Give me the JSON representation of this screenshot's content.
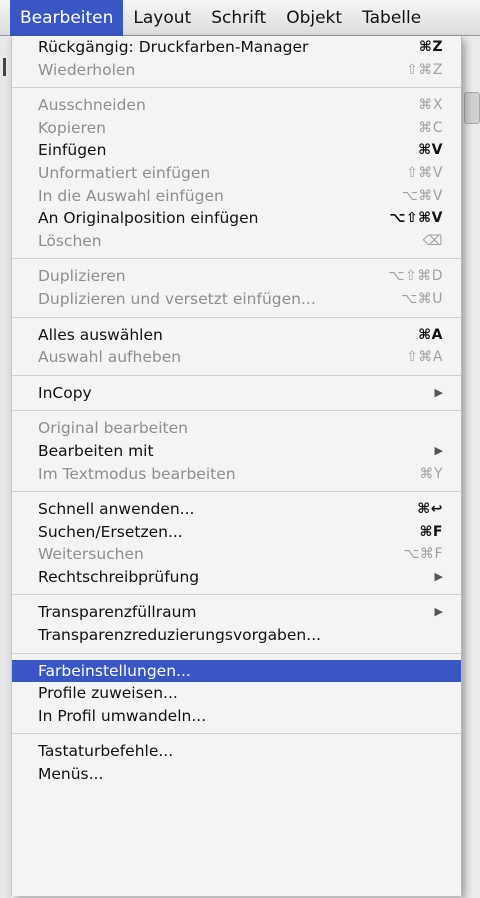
{
  "menubar": {
    "items": [
      "Bearbeiten",
      "Layout",
      "Schrift",
      "Objekt",
      "Tabelle"
    ]
  },
  "menu": {
    "groups": [
      [
        {
          "label": "Rückgängig: Druckfarben-Manager",
          "shortcut": "⌘Z",
          "enabled": true
        },
        {
          "label": "Wiederholen",
          "shortcut": "⇧⌘Z",
          "enabled": false
        }
      ],
      [
        {
          "label": "Ausschneiden",
          "shortcut": "⌘X",
          "enabled": false
        },
        {
          "label": "Kopieren",
          "shortcut": "⌘C",
          "enabled": false
        },
        {
          "label": "Einfügen",
          "shortcut": "⌘V",
          "enabled": true
        },
        {
          "label": "Unformatiert einfügen",
          "shortcut": "⇧⌘V",
          "enabled": false
        },
        {
          "label": "In die Auswahl einfügen",
          "shortcut": "⌥⌘V",
          "enabled": false
        },
        {
          "label": "An Originalposition einfügen",
          "shortcut": "⌥⇧⌘V",
          "enabled": true
        },
        {
          "label": "Löschen",
          "shortcut": "⌫",
          "enabled": false
        }
      ],
      [
        {
          "label": "Duplizieren",
          "shortcut": "⌥⇧⌘D",
          "enabled": false
        },
        {
          "label": "Duplizieren und versetzt einfügen...",
          "shortcut": "⌥⌘U",
          "enabled": false
        }
      ],
      [
        {
          "label": "Alles auswählen",
          "shortcut": "⌘A",
          "enabled": true
        },
        {
          "label": "Auswahl aufheben",
          "shortcut": "⇧⌘A",
          "enabled": false
        }
      ],
      [
        {
          "label": "InCopy",
          "submenu": true,
          "enabled": true
        }
      ],
      [
        {
          "label": "Original bearbeiten",
          "enabled": false
        },
        {
          "label": "Bearbeiten mit",
          "submenu": true,
          "enabled": true
        },
        {
          "label": "Im Textmodus bearbeiten",
          "shortcut": "⌘Y",
          "enabled": false
        }
      ],
      [
        {
          "label": "Schnell anwenden...",
          "shortcut": "⌘↩",
          "enabled": true
        },
        {
          "label": "Suchen/Ersetzen...",
          "shortcut": "⌘F",
          "enabled": true
        },
        {
          "label": "Weitersuchen",
          "shortcut": "⌥⌘F",
          "enabled": false
        },
        {
          "label": "Rechtschreibprüfung",
          "submenu": true,
          "enabled": true
        }
      ],
      [
        {
          "label": "Transparenzfüllraum",
          "submenu": true,
          "enabled": true
        },
        {
          "label": "Transparenzreduzierungsvorgaben...",
          "enabled": true
        }
      ],
      [
        {
          "label": "Farbeinstellungen...",
          "enabled": true,
          "highlighted": true
        },
        {
          "label": "Profile zuweisen...",
          "enabled": true
        },
        {
          "label": "In Profil umwandeln...",
          "enabled": true
        }
      ],
      [
        {
          "label": "Tastaturbefehle...",
          "enabled": true
        },
        {
          "label": "Menüs...",
          "enabled": true
        }
      ]
    ]
  },
  "colors": {
    "highlight": "#3a55c4",
    "disabled_text": "#8e8e8e",
    "menu_bg": "#f4f4f4"
  },
  "icons": {
    "submenu": "triangle-right-icon"
  }
}
